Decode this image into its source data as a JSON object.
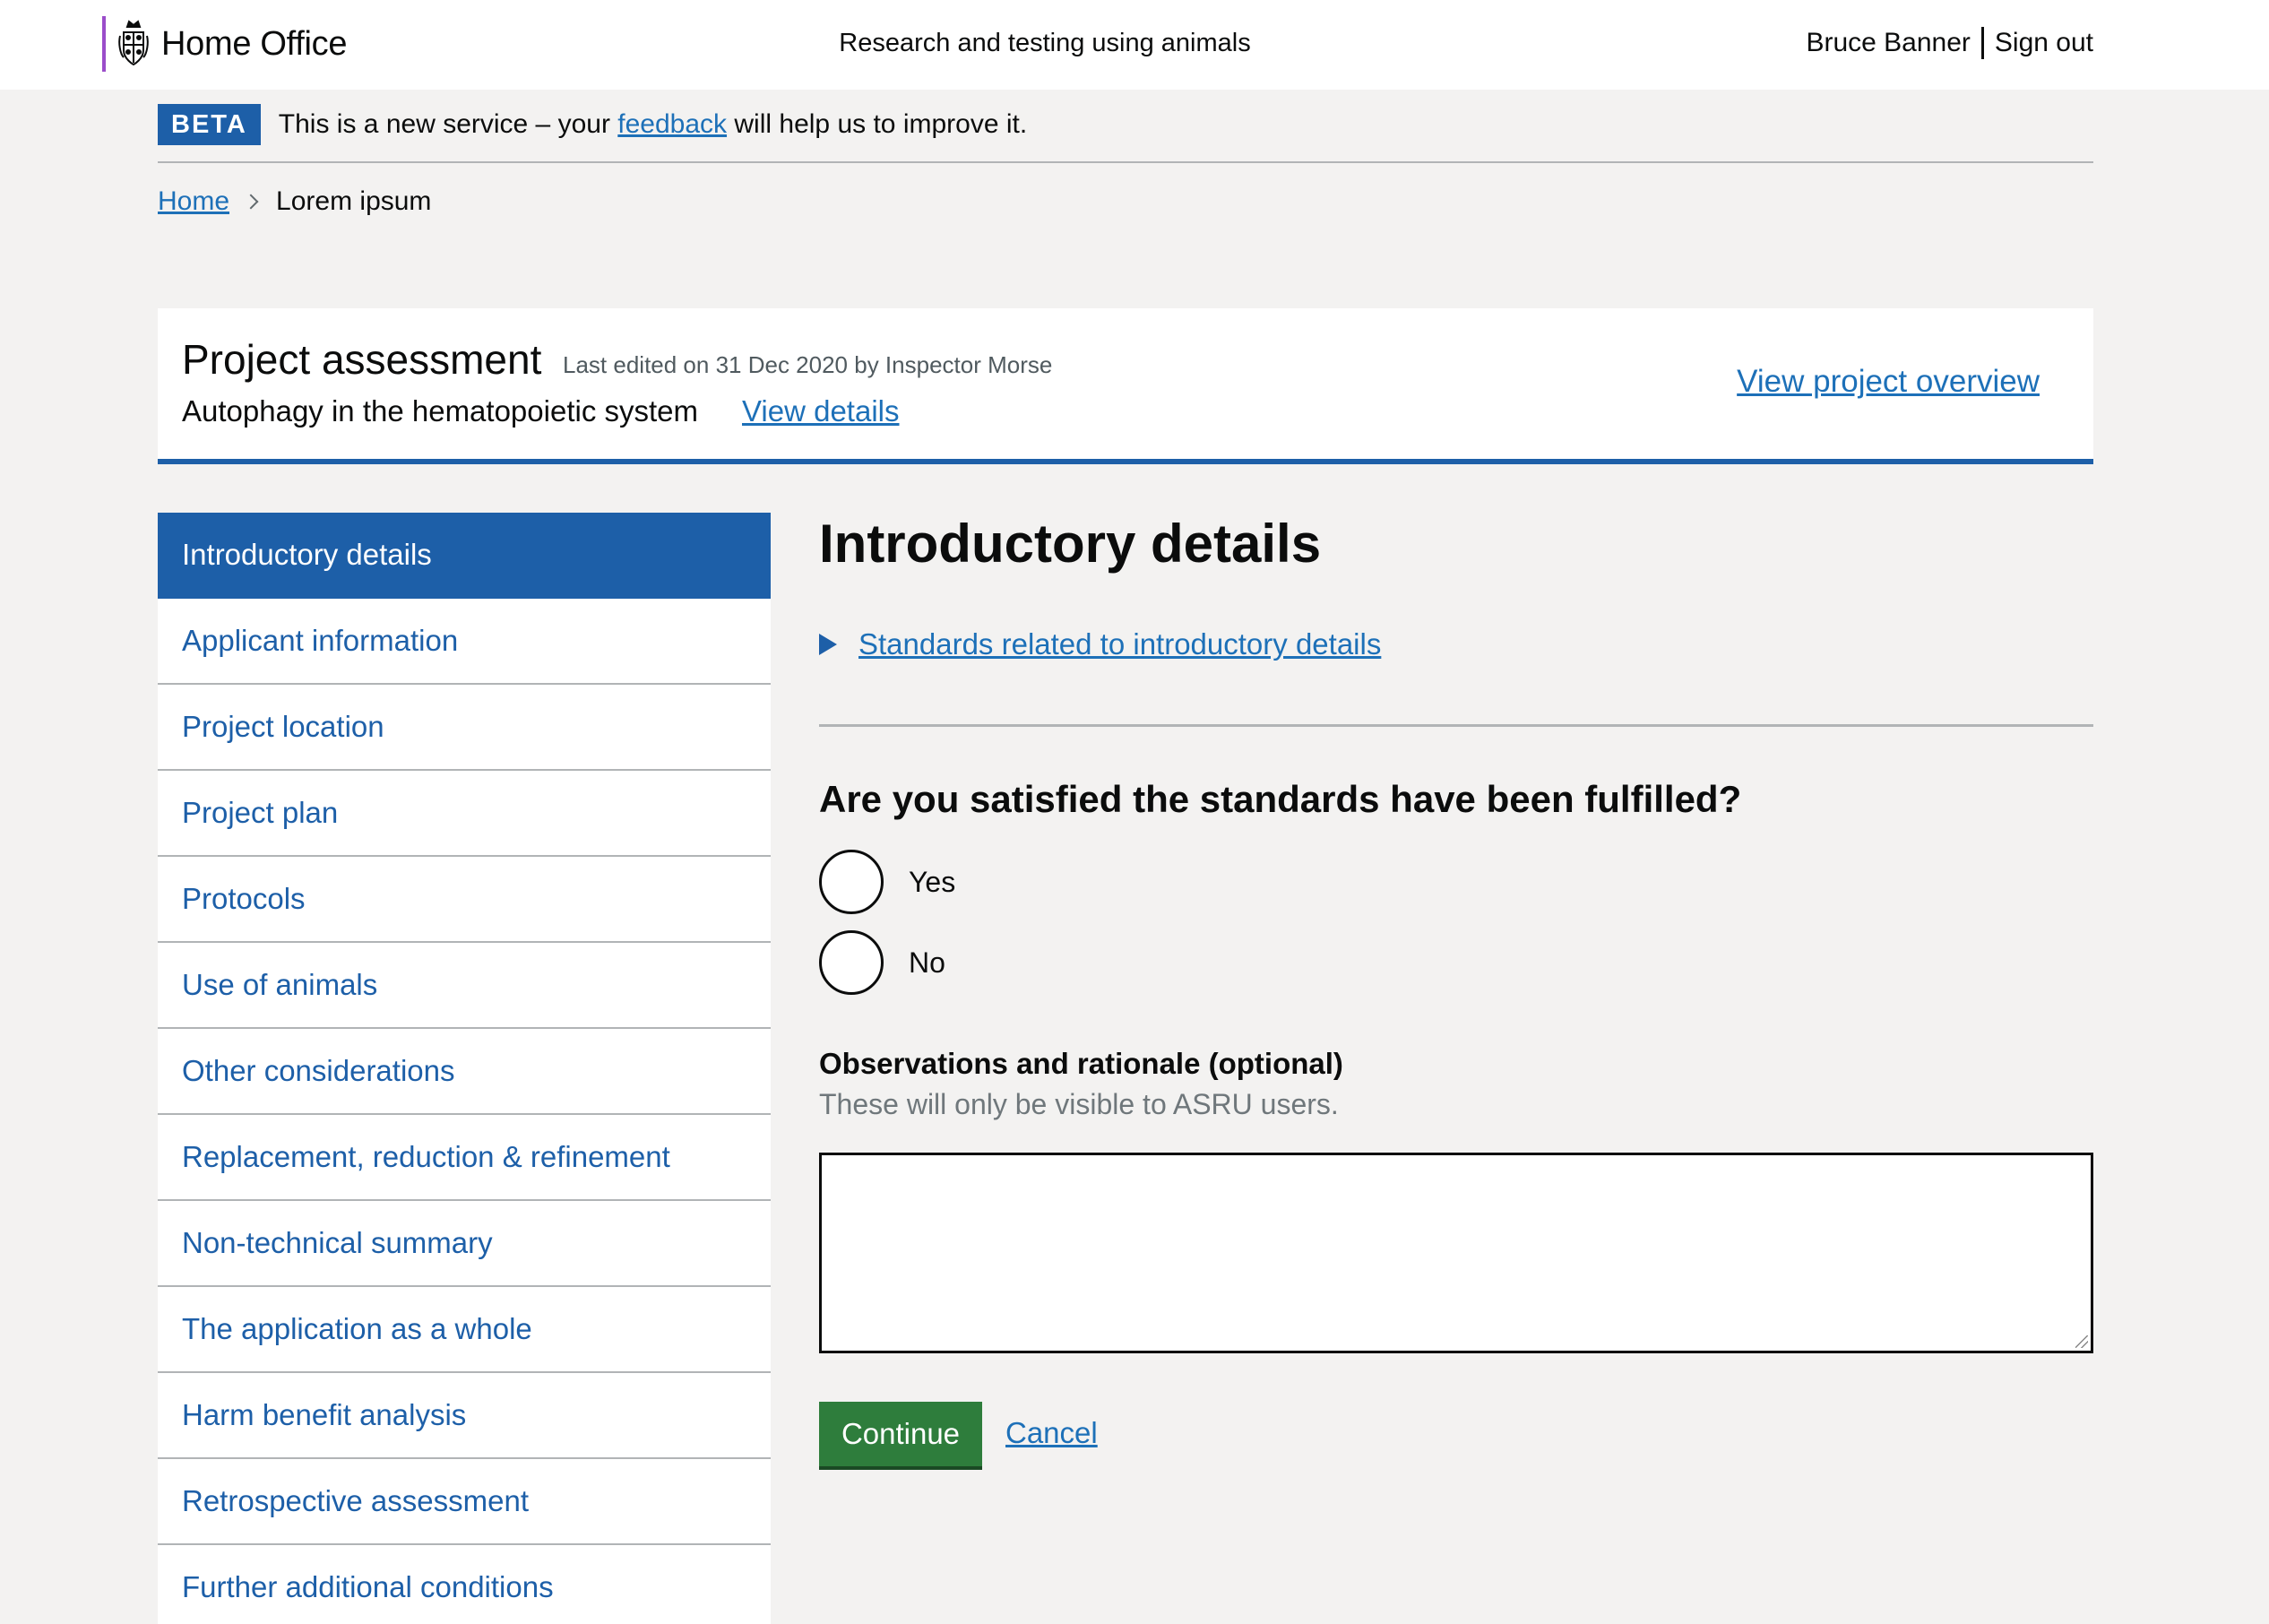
{
  "header": {
    "brand": "Home Office",
    "service_name": "Research and testing using animals",
    "user_name": "Bruce Banner",
    "sign_out": "Sign out"
  },
  "beta": {
    "tag": "BETA",
    "message_before": "This is a new service – your",
    "link": "feedback",
    "message_after": "will help us to improve it."
  },
  "breadcrumb": {
    "home": "Home",
    "current": "Lorem ipsum"
  },
  "project": {
    "title": "Project assessment",
    "last_edited": "Last edited on 31 Dec 2020 by Inspector Morse",
    "subtitle": "Autophagy in the hematopoietic system",
    "view_details": "View details",
    "view_overview": "View project overview"
  },
  "sidenav": {
    "items": [
      {
        "label": "Introductory details",
        "active": true
      },
      {
        "label": "Applicant information"
      },
      {
        "label": "Project location"
      },
      {
        "label": "Project plan"
      },
      {
        "label": "Protocols"
      },
      {
        "label": "Use of animals"
      },
      {
        "label": "Other considerations"
      },
      {
        "label": "Replacement, reduction & refinement"
      },
      {
        "label": "Non-technical summary"
      },
      {
        "label": "The application as a whole"
      },
      {
        "label": "Harm benefit analysis"
      },
      {
        "label": "Retrospective assessment"
      },
      {
        "label": "Further additional conditions"
      }
    ]
  },
  "main": {
    "heading": "Introductory details",
    "standards_link": "Standards related to introductory details",
    "question": "Are you satisfied the standards have been fulfilled?",
    "options": [
      "Yes",
      "No"
    ],
    "observations_label": "Observations and rationale (optional)",
    "observations_hint": "These will only be visible to ASRU users.",
    "observations_value": "",
    "continue_label": "Continue",
    "cancel_label": "Cancel"
  },
  "colors": {
    "brand_blue": "#1d5fa8",
    "link_blue": "#1d70b8",
    "button_green": "#2e7d3c",
    "home_office_purple": "#9b4dca",
    "page_background": "#f3f2f1"
  }
}
